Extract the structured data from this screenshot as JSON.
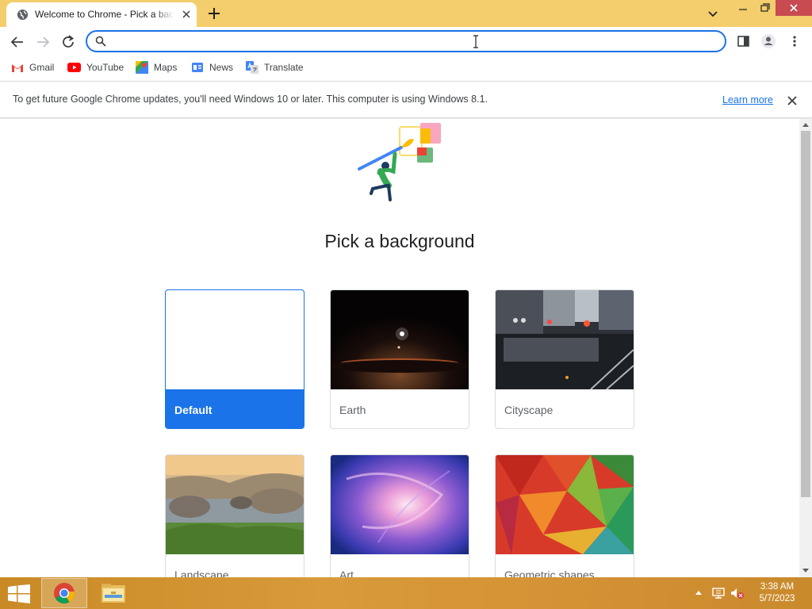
{
  "browser": {
    "tab_title": "Welcome to Chrome - Pick a background",
    "omnibox_value": "",
    "omnibox_placeholder": ""
  },
  "bookmarks": [
    {
      "label": "Gmail",
      "icon": "gmail-icon"
    },
    {
      "label": "YouTube",
      "icon": "youtube-icon"
    },
    {
      "label": "Maps",
      "icon": "maps-icon"
    },
    {
      "label": "News",
      "icon": "news-icon"
    },
    {
      "label": "Translate",
      "icon": "translate-icon"
    }
  ],
  "infobar": {
    "message": "To get future Google Chrome updates, you'll need Windows 10 or later. This computer is using Windows 8.1.",
    "link": "Learn more"
  },
  "page": {
    "title": "Pick a background",
    "backgrounds": [
      {
        "label": "Default",
        "selected": true
      },
      {
        "label": "Earth",
        "selected": false
      },
      {
        "label": "Cityscape",
        "selected": false
      },
      {
        "label": "Landscape",
        "selected": false
      },
      {
        "label": "Art",
        "selected": false
      },
      {
        "label": "Geometric shapes",
        "selected": false
      }
    ]
  },
  "taskbar": {
    "time": "3:38 AM",
    "date": "5/7/2023"
  },
  "colors": {
    "frame": "#f4cd6c",
    "accent": "#1a73e8",
    "taskbar": "#d49235"
  }
}
